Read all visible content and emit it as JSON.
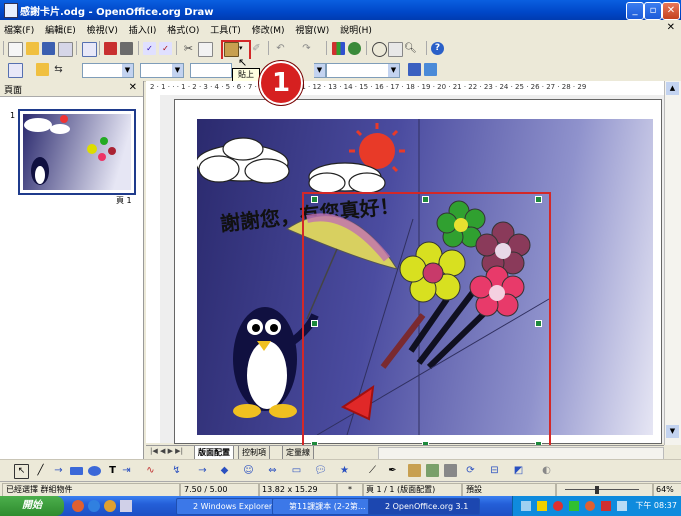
{
  "window": {
    "title": "感謝卡片.odg - OpenOffice.org Draw"
  },
  "menubar": {
    "items": [
      "檔案(F)",
      "編輯(E)",
      "檢視(V)",
      "插入(I)",
      "格式(O)",
      "工具(T)",
      "修改(M)",
      "視窗(W)",
      "說明(H)"
    ]
  },
  "tooltip": {
    "text": "貼上"
  },
  "callout": {
    "number": "1"
  },
  "slides_pane": {
    "title": "頁面",
    "thumb_number": "1",
    "thumb_label": "頁 1"
  },
  "ruler": {
    "labels": "2 · 1 · · · 1 · 2 · 3 · 4 · 5 · 6 · 7 · 8 · 9 · 10 · 11 · 12 · 13 · 14 · 15 · 16 · 17 · 18 · 19 · 20 · 21 · 22 · 23 · 24 · 25 · 26 · 27 · 28 · 29"
  },
  "slide": {
    "title_text": "謝謝您，有您真好！"
  },
  "tabs": {
    "layout": "版面配置",
    "controls": "控制項",
    "dimension_lines": "定量線"
  },
  "statusbar": {
    "selection": "已經選擇 群組物件",
    "position": "7.50 / 5.00",
    "size": "13.82 x 15.29",
    "asterisk": "*",
    "page": "頁 1 / 1 (版面配置)",
    "style": "預設",
    "zoom": "64%"
  },
  "taskbar": {
    "start": "開始",
    "tasks": [
      "2 Windows Explorer",
      "第11課課本 (2-2第...",
      "2 OpenOffice.org 3.1"
    ],
    "clock": "下午 08:37"
  },
  "colors": {
    "accent_red": "#d32828",
    "handle_green": "#1e8a3c",
    "title_blue": "#0047c8"
  }
}
